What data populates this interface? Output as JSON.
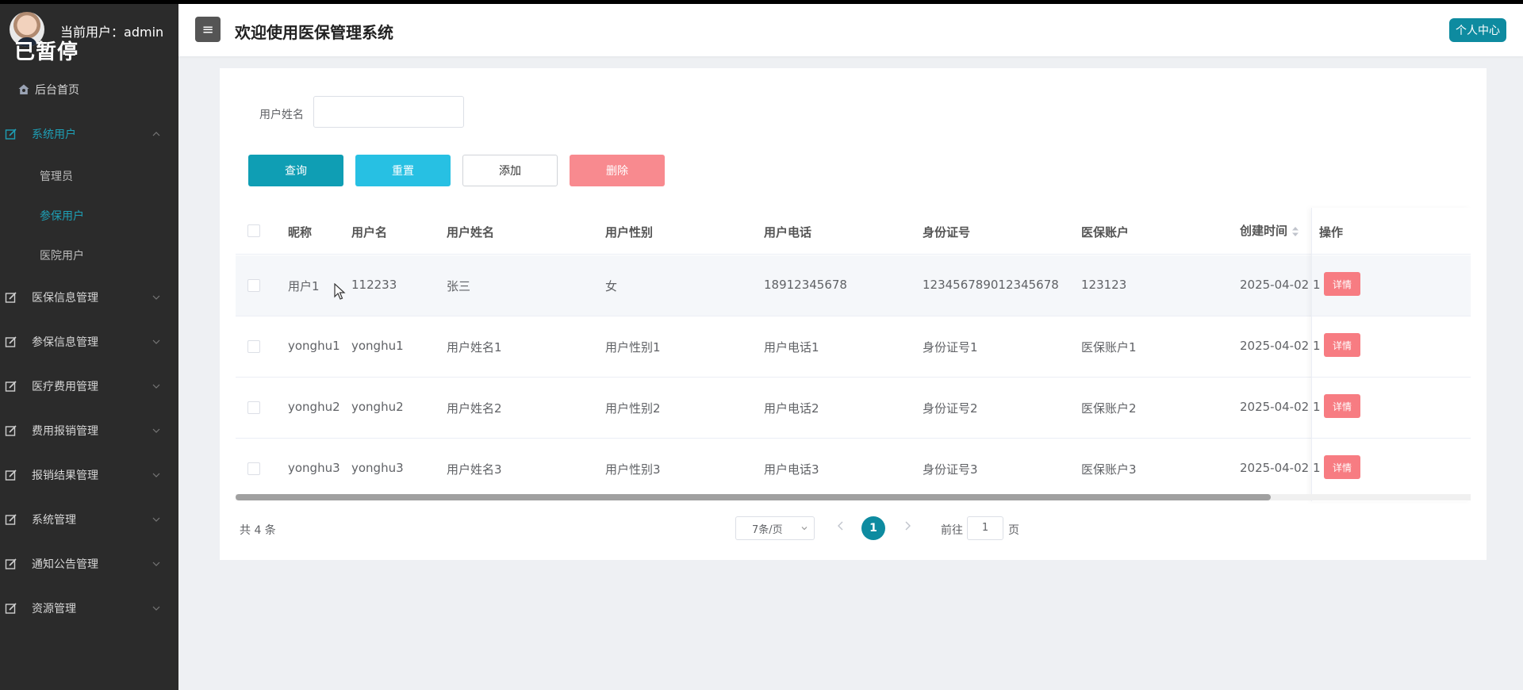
{
  "sidebar": {
    "current_user_label": "当前用户：",
    "current_user": "admin",
    "overlay_text": "已暂停",
    "home": "后台首页",
    "items": [
      {
        "label": "系统用户",
        "expanded": true,
        "children": [
          "管理员",
          "参保用户",
          "医院用户"
        ],
        "active_child": 1
      },
      {
        "label": "医保信息管理"
      },
      {
        "label": "参保信息管理"
      },
      {
        "label": "医疗费用管理"
      },
      {
        "label": "费用报销管理"
      },
      {
        "label": "报销结果管理"
      },
      {
        "label": "系统管理"
      },
      {
        "label": "通知公告管理"
      },
      {
        "label": "资源管理"
      }
    ]
  },
  "header": {
    "menu_icon": "≡",
    "title": "欢迎使用医保管理系统",
    "personal_center": "个人中心"
  },
  "search": {
    "label": "用户姓名",
    "value": "",
    "placeholder": ""
  },
  "buttons": {
    "query": "查询",
    "reset": "重置",
    "add": "添加",
    "delete": "删除"
  },
  "table": {
    "headers": [
      "昵称",
      "用户名",
      "用户姓名",
      "用户性别",
      "用户电话",
      "身份证号",
      "医保账户",
      "创建时间",
      "操作"
    ],
    "rows": [
      [
        "用户1",
        "112233",
        "张三",
        "女",
        "18912345678",
        "123456789012345678",
        "123123",
        "2025-04-02 1"
      ],
      [
        "yonghu1",
        "yonghu1",
        "用户姓名1",
        "用户性别1",
        "用户电话1",
        "身份证号1",
        "医保账户1",
        "2025-04-02 1"
      ],
      [
        "yonghu2",
        "yonghu2",
        "用户姓名2",
        "用户性别2",
        "用户电话2",
        "身份证号2",
        "医保账户2",
        "2025-04-02 1"
      ],
      [
        "yonghu3",
        "yonghu3",
        "用户姓名3",
        "用户性别3",
        "用户电话3",
        "身份证号3",
        "医保账户3",
        "2025-04-02 1"
      ]
    ],
    "action_label": "详情"
  },
  "pagination": {
    "total": "共 4 条",
    "page_size": "7条/页",
    "current_page": "1",
    "goto_label": "前往",
    "goto_value": "1",
    "page_unit": "页"
  },
  "colors": {
    "accent": "#0e8ba0",
    "reset": "#27c0e3",
    "danger": "#f88a8f",
    "sidebar_bg": "#2b2b2b"
  }
}
